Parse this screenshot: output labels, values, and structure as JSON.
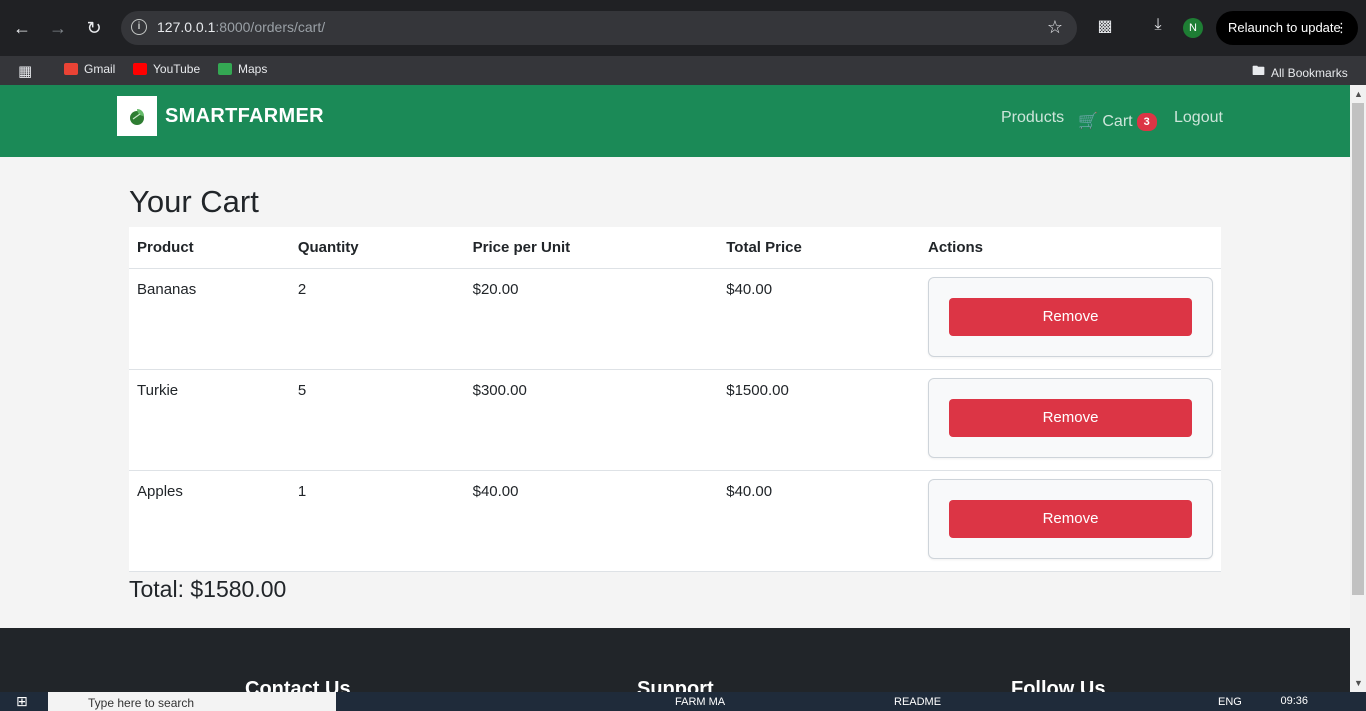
{
  "browser": {
    "url_host": "127.0.0.1",
    "url_path": ":8000/orders/cart/",
    "relaunch_label": "Relaunch to update",
    "avatar_letter": "N",
    "bookmarks": [
      "Gmail",
      "YouTube",
      "Maps"
    ],
    "all_bookmarks": "All Bookmarks"
  },
  "navbar": {
    "brand": "SMARTFARMER",
    "links": {
      "products": "Products",
      "cart": "Cart",
      "logout": "Logout"
    },
    "cart_count": "3"
  },
  "cart": {
    "title": "Your Cart",
    "headers": [
      "Product",
      "Quantity",
      "Price per Unit",
      "Total Price",
      "Actions"
    ],
    "rows": [
      {
        "product": "Bananas",
        "quantity": "2",
        "price": "$20.00",
        "total": "$40.00",
        "action": "Remove"
      },
      {
        "product": "Turkie",
        "quantity": "5",
        "price": "$300.00",
        "total": "$1500.00",
        "action": "Remove"
      },
      {
        "product": "Apples",
        "quantity": "1",
        "price": "$40.00",
        "total": "$40.00",
        "action": "Remove"
      }
    ],
    "grand_total": "Total: $1580.00"
  },
  "footer": {
    "headings": [
      "Contact Us",
      "Support",
      "Follow Us"
    ]
  },
  "taskbar": {
    "search_placeholder": "Type here to search",
    "items": [
      "README",
      "FARM MA"
    ],
    "lang": "ENG",
    "time": "09:36"
  },
  "colors": {
    "navbar": "#1b8a57",
    "danger": "#dc3545",
    "footer": "#212529"
  }
}
